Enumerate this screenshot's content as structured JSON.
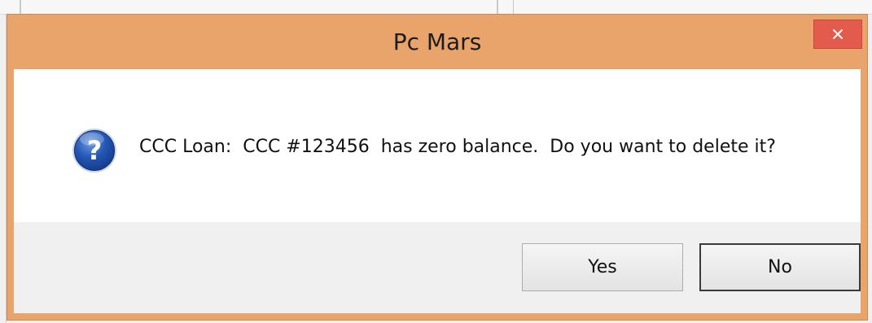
{
  "dialog": {
    "title": "Pc Mars",
    "message": "CCC Loan:  CCC #123456  has zero balance.  Do you want to delete it?",
    "icon": "question-icon",
    "close_icon": "close-icon",
    "buttons": {
      "yes_label": "Yes",
      "no_label": "No"
    }
  },
  "colors": {
    "title_bar": "#e9a46b",
    "close_button": "#e35b4c",
    "icon_blue": "#2356b5",
    "button_area": "#f0f0f0"
  }
}
